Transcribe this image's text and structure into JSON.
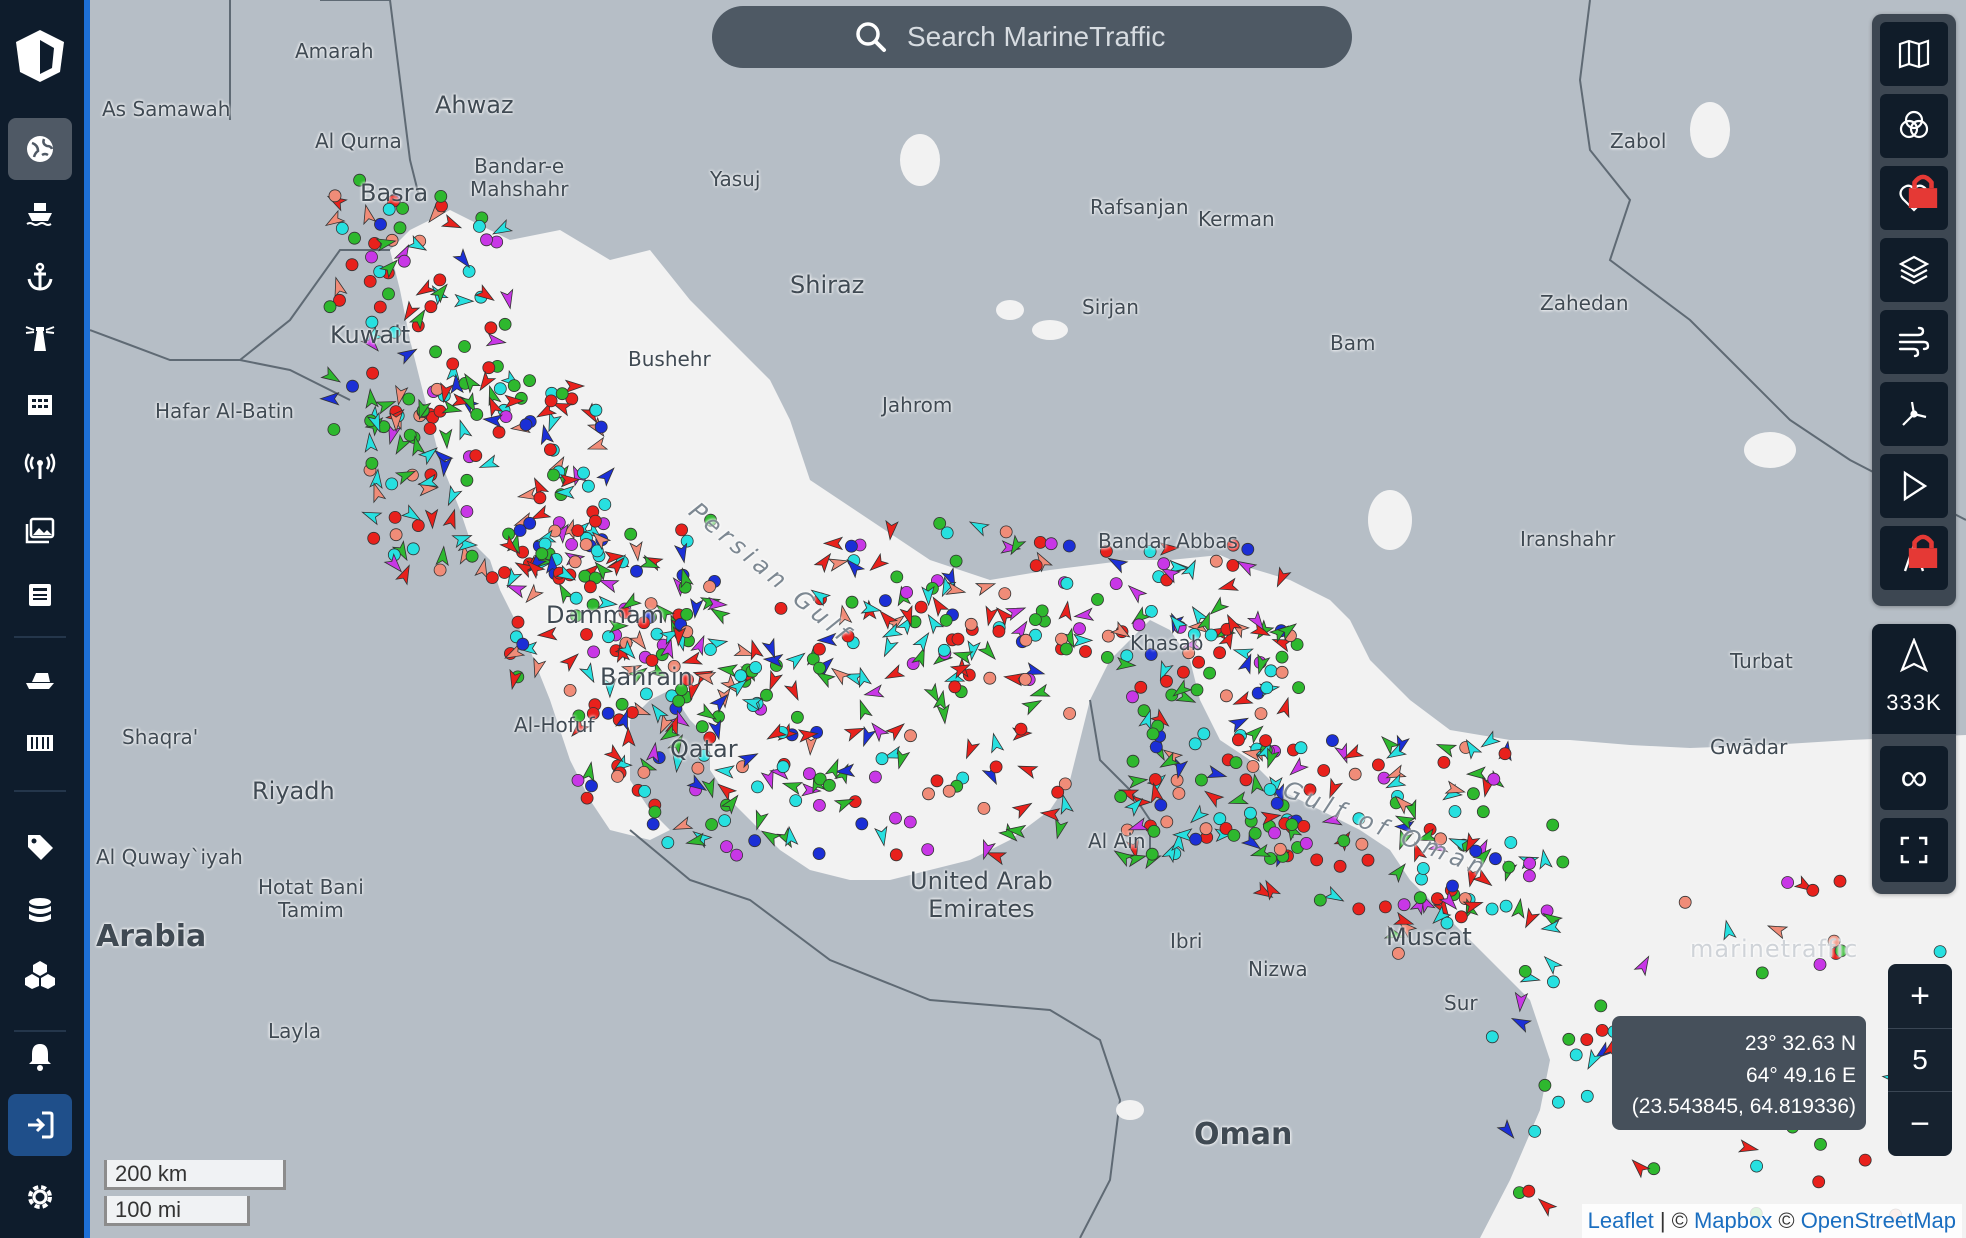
{
  "search": {
    "placeholder": "Search MarineTraffic"
  },
  "sidebar": {
    "items": [
      {
        "name": "live-map",
        "icon": "globe-icon"
      },
      {
        "name": "vessels",
        "icon": "ship-icon"
      },
      {
        "name": "ports",
        "icon": "anchor-icon"
      },
      {
        "name": "lighthouses",
        "icon": "lighthouse-icon"
      },
      {
        "name": "companies",
        "icon": "buildings-icon"
      },
      {
        "name": "stations",
        "icon": "antenna-icon"
      },
      {
        "name": "photos",
        "icon": "photos-icon"
      },
      {
        "name": "news",
        "icon": "news-icon"
      },
      {
        "name": "fleets",
        "icon": "ferry-icon"
      },
      {
        "name": "containers",
        "icon": "container-icon"
      },
      {
        "name": "tags",
        "icon": "tag-icon"
      },
      {
        "name": "data",
        "icon": "database-icon"
      },
      {
        "name": "integrations",
        "icon": "cubes-icon"
      },
      {
        "name": "notifications",
        "icon": "bell-icon"
      },
      {
        "name": "login",
        "icon": "login-icon"
      },
      {
        "name": "settings",
        "icon": "gear-icon"
      }
    ]
  },
  "map": {
    "places": [
      {
        "name": "Amarah",
        "size": "s"
      },
      {
        "name": "Ahwaz",
        "size": "m"
      },
      {
        "name": "As Samawah",
        "size": "s"
      },
      {
        "name": "Al Qurna",
        "size": "s"
      },
      {
        "name": "Basra",
        "size": "m"
      },
      {
        "name": "Bandar-e\nMahshahr",
        "size": "s"
      },
      {
        "name": "Yasuj",
        "size": "s"
      },
      {
        "name": "Shiraz",
        "size": "m"
      },
      {
        "name": "Rafsanjan",
        "size": "s"
      },
      {
        "name": "Kerman",
        "size": "s"
      },
      {
        "name": "Sirjan",
        "size": "s"
      },
      {
        "name": "Zabol",
        "size": "s"
      },
      {
        "name": "Zahedan",
        "size": "s"
      },
      {
        "name": "Bam",
        "size": "s"
      },
      {
        "name": "Kuwait",
        "size": "m"
      },
      {
        "name": "Bushehr",
        "size": "s"
      },
      {
        "name": "Jahrom",
        "size": "s"
      },
      {
        "name": "Hafar Al-Batin",
        "size": "s"
      },
      {
        "name": "Bandar Abbas",
        "size": "s"
      },
      {
        "name": "Iranshahr",
        "size": "s"
      },
      {
        "name": "Dammam",
        "size": "m"
      },
      {
        "name": "Bahrain",
        "size": "m"
      },
      {
        "name": "Khasab",
        "size": "s"
      },
      {
        "name": "Turbat",
        "size": "s"
      },
      {
        "name": "Qatar",
        "size": "m"
      },
      {
        "name": "Al-Hofuf",
        "size": "s"
      },
      {
        "name": "Shaqra'",
        "size": "s"
      },
      {
        "name": "Gwādar",
        "size": "s"
      },
      {
        "name": "Riyadh",
        "size": "m"
      },
      {
        "name": "Al Quway`iyah",
        "size": "s"
      },
      {
        "name": "Al Ain",
        "size": "s"
      },
      {
        "name": "United Arab\nEmirates",
        "size": "m"
      },
      {
        "name": "Hotat Bani\nTamim",
        "size": "s"
      },
      {
        "name": "Ibri",
        "size": "s"
      },
      {
        "name": "Nizwa",
        "size": "s"
      },
      {
        "name": "Muscat",
        "size": "m"
      },
      {
        "name": "Sur",
        "size": "s"
      },
      {
        "name": "Arabia",
        "size": "l"
      },
      {
        "name": "Layla",
        "size": "s"
      },
      {
        "name": "Oman",
        "size": "l"
      },
      {
        "name": "Persian Gulf",
        "size": "sea"
      },
      {
        "name": "Gulf of Oman",
        "size": "sea"
      }
    ],
    "watermark": "marinetraffic"
  },
  "toolbar": {
    "buttons": [
      {
        "name": "map-options",
        "icon": "map-icon"
      },
      {
        "name": "filters",
        "icon": "circles-icon"
      },
      {
        "name": "my-fleets",
        "icon": "heart-icon",
        "locked": true
      },
      {
        "name": "layers",
        "icon": "layers-icon"
      },
      {
        "name": "weather",
        "icon": "wind-icon"
      },
      {
        "name": "distance",
        "icon": "measure-icon"
      },
      {
        "name": "playback",
        "icon": "play-icon"
      },
      {
        "name": "routes",
        "icon": "route-icon",
        "locked": true
      }
    ],
    "vessel_count": "333K",
    "infinity": "∞"
  },
  "coords": {
    "lat": "23° 32.63 N",
    "lon": "64° 49.16 E",
    "decimal": "(23.543845, 64.819336)"
  },
  "zoom": {
    "plus": "+",
    "level": "5",
    "minus": "−"
  },
  "scale": {
    "km": "200 km",
    "mi": "100 mi"
  },
  "attribution": {
    "leaflet": "Leaflet",
    "sep": " | © ",
    "mapbox": "Mapbox",
    "copy": " © ",
    "osm": "OpenStreetMap"
  },
  "colors": {
    "land": "#f2f2f2",
    "sea": "#b6bec6",
    "sidebar": "#0e1c2c",
    "accent": "#1d6fd6",
    "cargo": "#2eb82e",
    "tanker": "#e8211c",
    "passenger": "#1b2fd6",
    "tug": "#27e0e0",
    "pleasure": "#c837e6",
    "fishing": "#f08c78"
  }
}
